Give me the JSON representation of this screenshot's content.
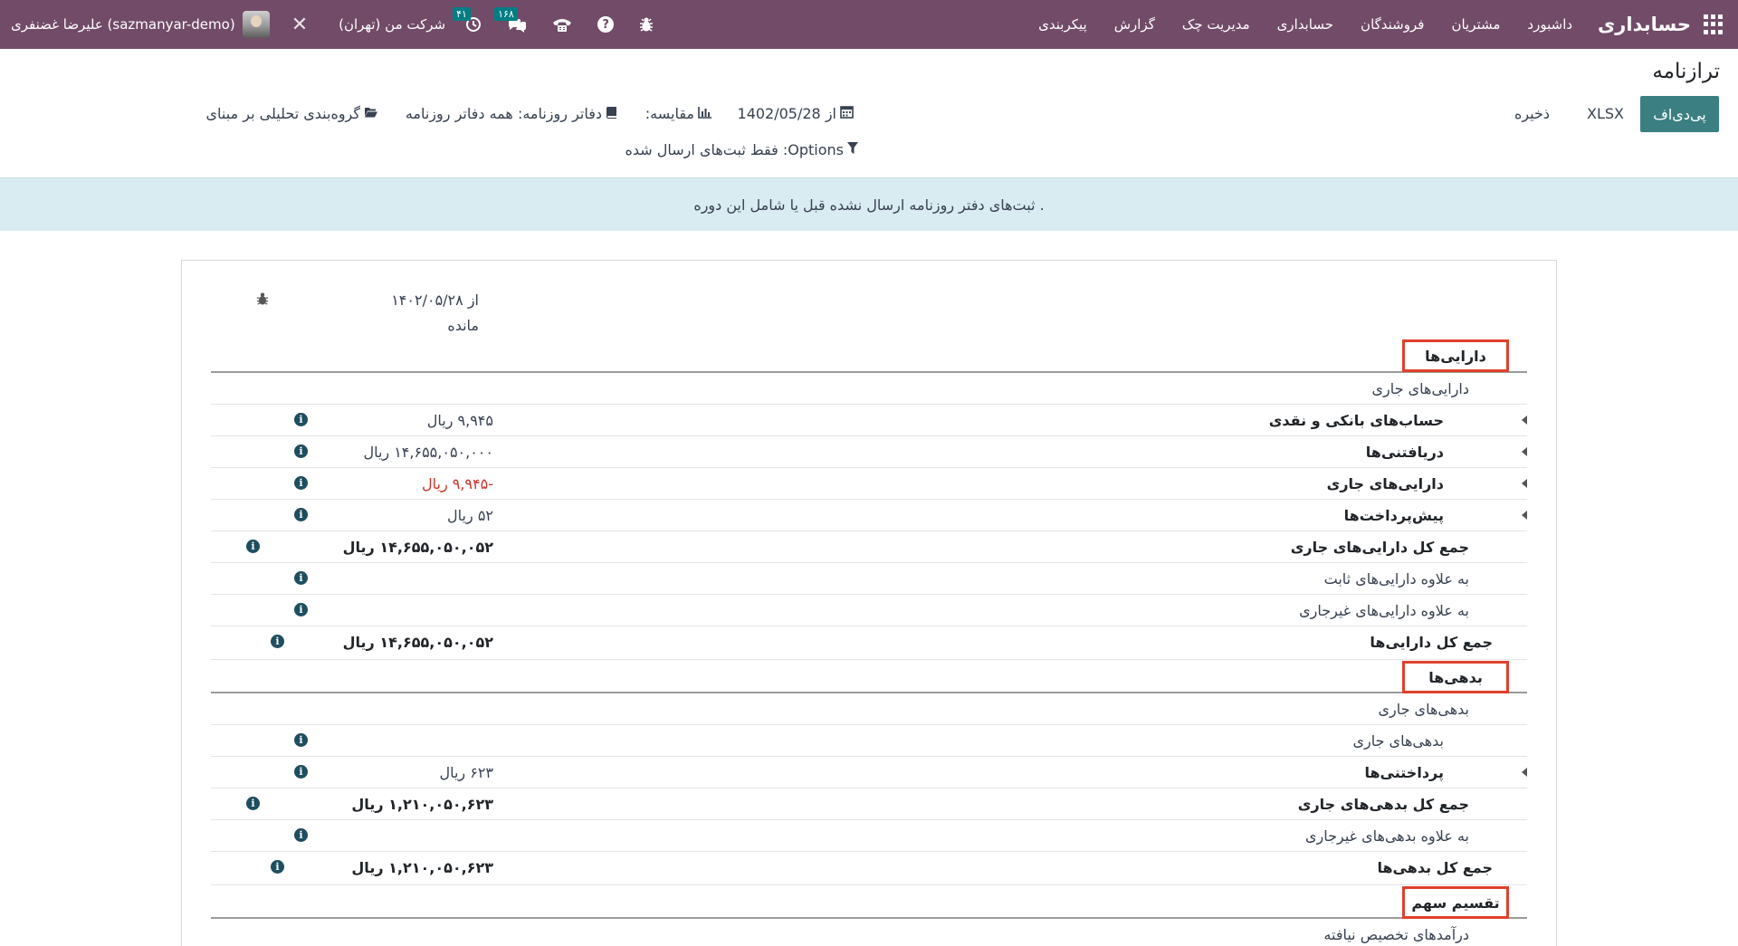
{
  "navbar": {
    "brand": "حسابداری",
    "menu": [
      "داشبورد",
      "مشتریان",
      "فروشندگان",
      "حسابداری",
      "مدیریت چک",
      "گزارش",
      "پیکربندی"
    ],
    "company": "شرکت من (تهران)",
    "user": "علیرضا غضنفری (sazmanyar-demo)",
    "activity_count": "۴۱",
    "message_count": "۱۶۸",
    "icons": [
      "apps-icon",
      "bug-icon",
      "help-icon",
      "phone-icon",
      "chat-icon",
      "clock-icon",
      "tools-icon"
    ]
  },
  "control": {
    "title": "ترازنامه",
    "pdf_label": "پی‌دی‌اف",
    "xlsx_label": "XLSX",
    "save_label": "ذخیره",
    "date_filter": "از 1402/05/28",
    "compare_filter": "مقایسه:",
    "journals_filter": "دفاتر روزنامه: همه دفاتر روزنامه",
    "analytic_filter": "گروه‌بندی تحلیلی بر مبنای",
    "options_filter": "Options: فقط ثبت‌های ارسال شده"
  },
  "alert": {
    "text": ". ثبت‌های دفتر روزنامه ارسال نشده قبل یا شامل این دوره"
  },
  "report": {
    "column_date": "از ۱۴۰۲/۰۵/۲۸",
    "column_balance": "مانده",
    "assets_title": "دارایی‌ها",
    "current_assets_header": "دارایی‌های جاری",
    "bank_cash": "حساب‌های بانکی و نقدی",
    "bank_cash_amount": "۹,۹۴۵ ریال",
    "receivables": "دریافتنی‌ها",
    "receivables_amount": "۱۴,۶۵۵,۰۵۰,۰۰۰ ریال",
    "current_assets": "دارایی‌های جاری",
    "current_assets_amount": "-۹,۹۴۵ ریال",
    "prepayments": "پیش‌پرداخت‌ها",
    "prepayments_amount": "۵۲ ریال",
    "total_current_assets": "جمع کل دارایی‌های جاری",
    "total_current_assets_amount": "۱۴,۶۵۵,۰۵۰,۰۵۲ ریال",
    "plus_fixed_assets": "به علاوه دارایی‌های ثابت",
    "plus_noncurrent_assets": "به علاوه دارایی‌های غیرجاری",
    "total_assets": "جمع کل دارایی‌ها",
    "total_assets_amount": "۱۴,۶۵۵,۰۵۰,۰۵۲ ریال",
    "liabilities_title": "بدهی‌ها",
    "current_liabilities_header": "بدهی‌های جاری",
    "current_liabilities": "بدهی‌های جاری",
    "payables": "پرداختنی‌ها",
    "payables_amount": "۶۲۳ ریال",
    "total_current_liabilities": "جمع کل بدهی‌های جاری",
    "total_current_liabilities_amount": "۱,۲۱۰,۰۵۰,۶۲۳ ریال",
    "plus_noncurrent_liabilities": "به علاوه بدهی‌های غیرجاری",
    "total_liabilities": "جمع کل بدهی‌ها",
    "total_liabilities_amount": "۱,۲۱۰,۰۵۰,۶۲۳ ریال",
    "equity_title": "تقسیم سهم",
    "unallocated_earnings": "درآمدهای تخصیص نیافته"
  },
  "colors": {
    "navbar": "#714b67",
    "primary_button": "#3c7f82",
    "alert_bg": "#d9ecf2",
    "highlight_box": "#e0402d",
    "negative": "#d0312d"
  }
}
